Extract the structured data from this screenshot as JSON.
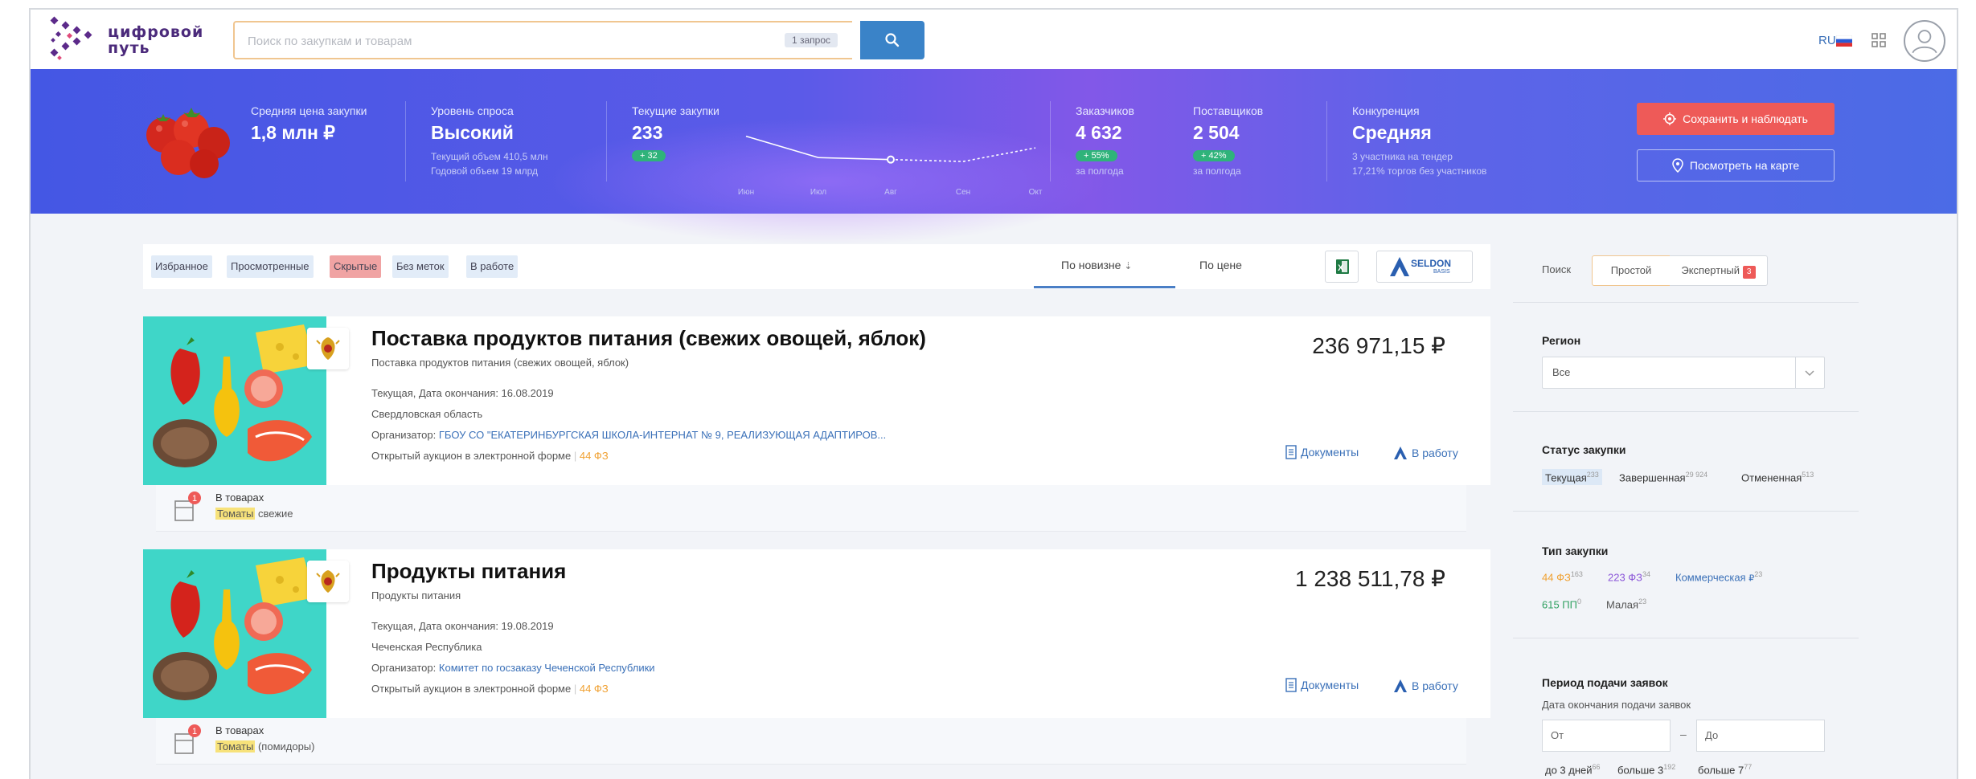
{
  "header": {
    "logo_text": [
      "цифровой",
      "путь"
    ],
    "search_placeholder": "Поиск по закупкам и товарам",
    "request_badge": "1 запрос",
    "lang": "RU"
  },
  "hero": {
    "avg_price": {
      "label": "Средняя цена закупки",
      "value": "1,8 млн ₽"
    },
    "demand": {
      "label": "Уровень спроса",
      "value": "Высокий",
      "sub1": "Текущий объем 410,5 млн",
      "sub2": "Годовой объем 19 млрд"
    },
    "current": {
      "label": "Текущие закупки",
      "value": "233",
      "pill": "+ 32"
    },
    "chart_data": {
      "type": "line",
      "categories": [
        "Июн",
        "Июл",
        "Авг",
        "Сен",
        "Окт"
      ],
      "values": [
        10,
        4.5,
        4,
        3.5,
        7
      ],
      "ylim": [
        0,
        12
      ]
    },
    "customers": {
      "label": "Заказчиков",
      "value": "4 632",
      "pill": "+ 55%",
      "sub": "за полгода"
    },
    "suppliers": {
      "label": "Поставщиков",
      "value": "2 504",
      "pill": "+ 42%",
      "sub": "за полгода"
    },
    "competition": {
      "label": "Конкуренция",
      "value": "Средняя",
      "sub1": "3 участника на тендер",
      "sub2": "17,21% торгов без участников"
    },
    "save_button": "Сохранить и наблюдать",
    "map_button": "Посмотреть на карте"
  },
  "filters": {
    "tags": [
      "Избранное",
      "Просмотренные",
      "Скрытые",
      "Без меток",
      "В работе"
    ],
    "sort_new": "По новизне",
    "sort_price": "По цене",
    "seldon": "SELDON",
    "seldon_sub": "BASIS"
  },
  "cards": [
    {
      "title": "Поставка продуктов питания (свежих овощей, яблок)",
      "subtitle": "Поставка продуктов питания (свежих овощей, яблок)",
      "status": "Текущая, Дата окончания: 16.08.2019",
      "region": "Свердловская область",
      "org_label": "Организатор:",
      "org": "ГБОУ СО \"ЕКАТЕРИНБУРГСКАЯ ШКОЛА-ИНТЕРНАТ № 9, РЕАЛИЗУЮЩАЯ АДАПТИРОВ...",
      "auction": "Открытый аукцион в электронной форме",
      "fz": "44 ФЗ",
      "price": "236 971,15 ₽",
      "docs": "Документы",
      "work": "В работу",
      "goods_badge": "1",
      "goods_label": "В товарах",
      "goods_hl": "Томаты",
      "goods_rest": "свежие"
    },
    {
      "title": "Продукты питания",
      "subtitle": "Продукты питания",
      "status": "Текущая, Дата окончания: 19.08.2019",
      "region": "Чеченская Республика",
      "org_label": "Организатор:",
      "org": "Комитет по госзаказу Чеченской Республики",
      "auction": "Открытый аукцион в электронной форме",
      "fz": "44 ФЗ",
      "price": "1 238 511,78 ₽",
      "docs": "Документы",
      "work": "В работу",
      "goods_badge": "1",
      "goods_label": "В товарах",
      "goods_hl": "Томаты",
      "goods_rest": "(помидоры)"
    }
  ],
  "panel": {
    "search_label": "Поиск",
    "mode_simple": "Простой",
    "mode_expert": "Экспертный",
    "expert_badge": "3",
    "region_title": "Регион",
    "region_value": "Все",
    "status_title": "Статус закупки",
    "status_items": [
      {
        "label": "Текущая",
        "count": "233"
      },
      {
        "label": "Завершенная",
        "count": "29 924"
      },
      {
        "label": "Отмененная",
        "count": "513"
      }
    ],
    "type_title": "Тип закупки",
    "type_items": [
      {
        "label": "44 ФЗ",
        "count": "163",
        "color": "#f0a030"
      },
      {
        "label": "223 ФЗ",
        "count": "34",
        "color": "#8b56d8"
      },
      {
        "label": "Коммерческая",
        "count": "23",
        "color": "#3a70b8"
      },
      {
        "label": "615 ПП",
        "count": "0",
        "color": "#2fa060"
      },
      {
        "label": "Малая",
        "count": "23",
        "color": "#555555"
      }
    ],
    "period_title": "Период подачи заявок",
    "period_sub": "Дата окончания подачи заявок",
    "from_ph": "От",
    "to_ph": "До",
    "dash": "–",
    "quick": [
      {
        "label": "до 3 дней",
        "count": "66"
      },
      {
        "label": "больше 3",
        "count": "192"
      },
      {
        "label": "больше 7",
        "count": "77"
      }
    ]
  },
  "colors": {
    "accent": "#3a83c8",
    "save": "#ee5a58",
    "hero_start": "#4457e4",
    "hero_mid": "#8258e8"
  }
}
